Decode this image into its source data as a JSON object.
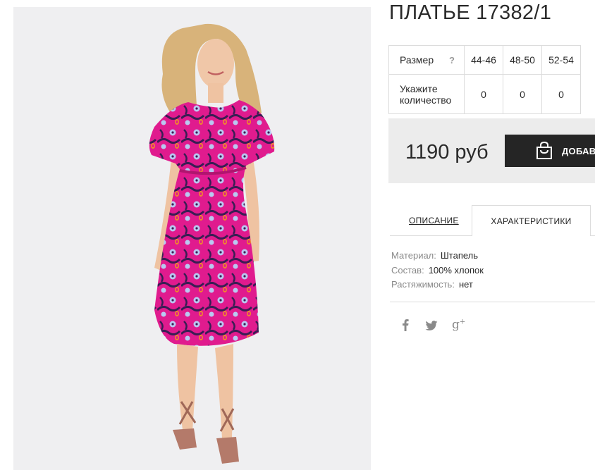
{
  "product": {
    "title": "ПЛАТЬЕ 17382/1",
    "image_alt": "Model wearing pink floral print dress"
  },
  "sizes": {
    "header_label": "Размер",
    "help_label": "?",
    "options": [
      "44-46",
      "48-50",
      "52-54"
    ],
    "qty_label_line1": "Укажите",
    "qty_label_line2": "количество",
    "quantities": [
      "0",
      "0",
      "0"
    ]
  },
  "purchase": {
    "price": "1190 руб",
    "add_label": "ДОБАВИТЬ В КОРЗИНУ"
  },
  "tabs": {
    "description": "ОПИСАНИЕ",
    "characteristics": "ХАРАКТЕРИСТИКИ",
    "active": "characteristics"
  },
  "characteristics": [
    {
      "key": "Материал:",
      "value": "Штапель"
    },
    {
      "key": "Состав:",
      "value": "100% хлопок"
    },
    {
      "key": "Растяжимость:",
      "value": "нет"
    }
  ],
  "share": {
    "facebook": "f",
    "google_plus": "g+"
  },
  "colors": {
    "button_bg": "#252525",
    "price_box_bg": "#ececec",
    "dress_pink": "#e21a8f",
    "border": "#dcdcdc"
  }
}
